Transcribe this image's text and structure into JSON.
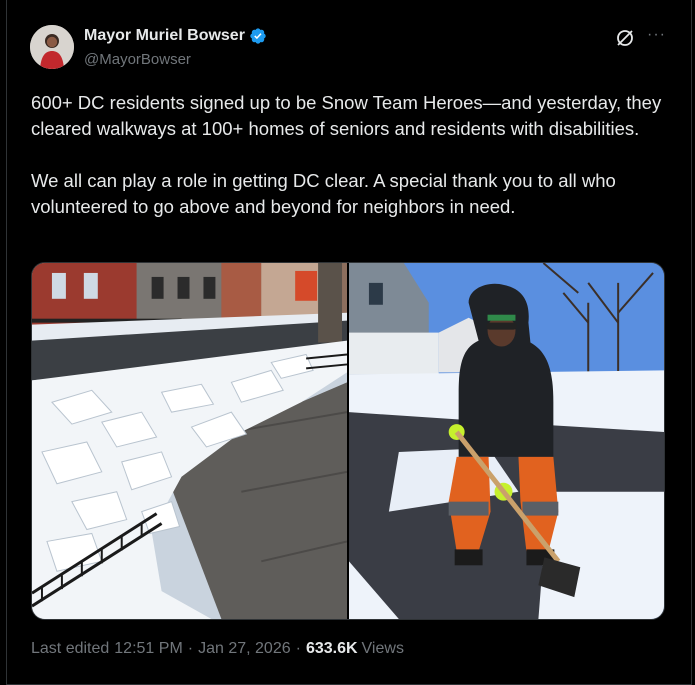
{
  "author": {
    "name": "Mayor Muriel Bowser",
    "handle": "@MayorBowser",
    "avatar_icon": "person-avatar",
    "verified_icon": "verified-badge-icon",
    "verified_color": "#1d9bf0"
  },
  "header_actions": {
    "grok_icon": "grok-icon",
    "more_icon": "more-options-icon",
    "more_label": "···"
  },
  "tweet": {
    "paragraph_1": "600+ DC residents signed up to be Snow Team Heroes—and yesterday, they cleared walkways at 100+ homes of seniors and residents with disabilities.",
    "paragraph_2": "We all can play a role in getting DC clear. A special thank you to all who volunteered to go above and beyond for neighbors in need."
  },
  "media": {
    "photos": [
      {
        "subject": "snow chunks piled beside a cleared sidewalk"
      },
      {
        "subject": "volunteer shoveling snow from a walkway"
      }
    ]
  },
  "footer": {
    "edited_label": "Last edited",
    "time": "12:51 PM",
    "separator": "·",
    "date": "Jan 27, 2026",
    "views_count": "633.6K",
    "views_label": "Views"
  },
  "colors": {
    "background": "#000000",
    "text_primary": "#e7e9ea",
    "text_secondary": "#71767b",
    "border": "#2f3336"
  }
}
